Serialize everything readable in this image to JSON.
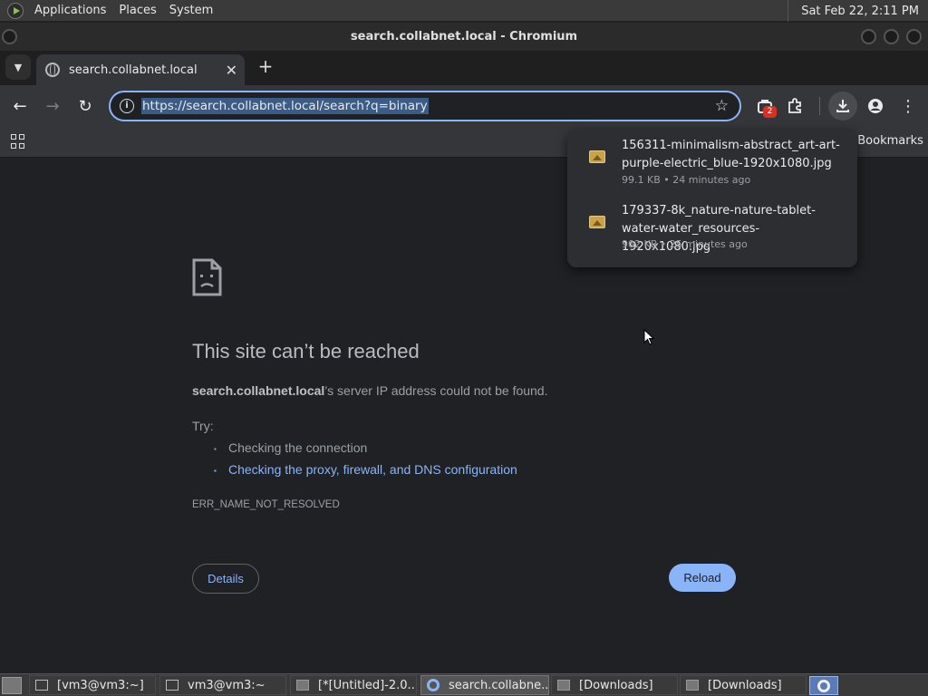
{
  "top_panel": {
    "menus": [
      "Applications",
      "Places",
      "System"
    ],
    "clock": "Sat Feb 22,  2:11 PM"
  },
  "window": {
    "title": "search.collabnet.local - Chromium"
  },
  "tabs": [
    {
      "title": "search.collabnet.local",
      "close": "✕"
    }
  ],
  "toolbar": {
    "url": "https://search.collabnet.local/search?q=binary",
    "extension_badge": "2",
    "back": "←",
    "forward": "→",
    "reload": "↻",
    "star": "☆",
    "menu": "⋮"
  },
  "bookmarks": {
    "all_bookmarks": "All Bookmarks"
  },
  "downloads": [
    {
      "name_line1": "156311-minimalism-abstract_art-art-",
      "name_line2": "purple-electric_blue-1920x1080.jpg",
      "meta": "99.1 KB • 24 minutes ago"
    },
    {
      "name_line1": "179337-8k_nature-nature-tablet-",
      "name_line2": "water-water_resources-1920x1080.jpg",
      "meta": "902 KB • 25 minutes ago"
    }
  ],
  "error": {
    "title": "This site can’t be reached",
    "host": "search.collabnet.local",
    "desc_rest": "’s server IP address could not be found.",
    "try_label": "Try:",
    "suggestions": [
      "Checking the connection",
      "Checking the proxy, firewall, and DNS configuration"
    ],
    "code": "ERR_NAME_NOT_RESOLVED",
    "details_label": "Details",
    "reload_label": "Reload"
  },
  "taskbar": [
    {
      "label": "[vm3@vm3:~]",
      "icon": "terminal-icon"
    },
    {
      "label": "vm3@vm3:~",
      "icon": "terminal-icon"
    },
    {
      "label": "[*[Untitled]-2.0...",
      "icon": "image-editor-icon"
    },
    {
      "label": "search.collabne...",
      "icon": "chromium-icon",
      "active": true
    },
    {
      "label": "[Downloads]",
      "icon": "folder-icon"
    },
    {
      "label": "[Downloads]",
      "icon": "folder-icon"
    }
  ],
  "colors": {
    "accent": "#8ab4f8",
    "background": "#202124",
    "toolbar": "#35363a"
  }
}
